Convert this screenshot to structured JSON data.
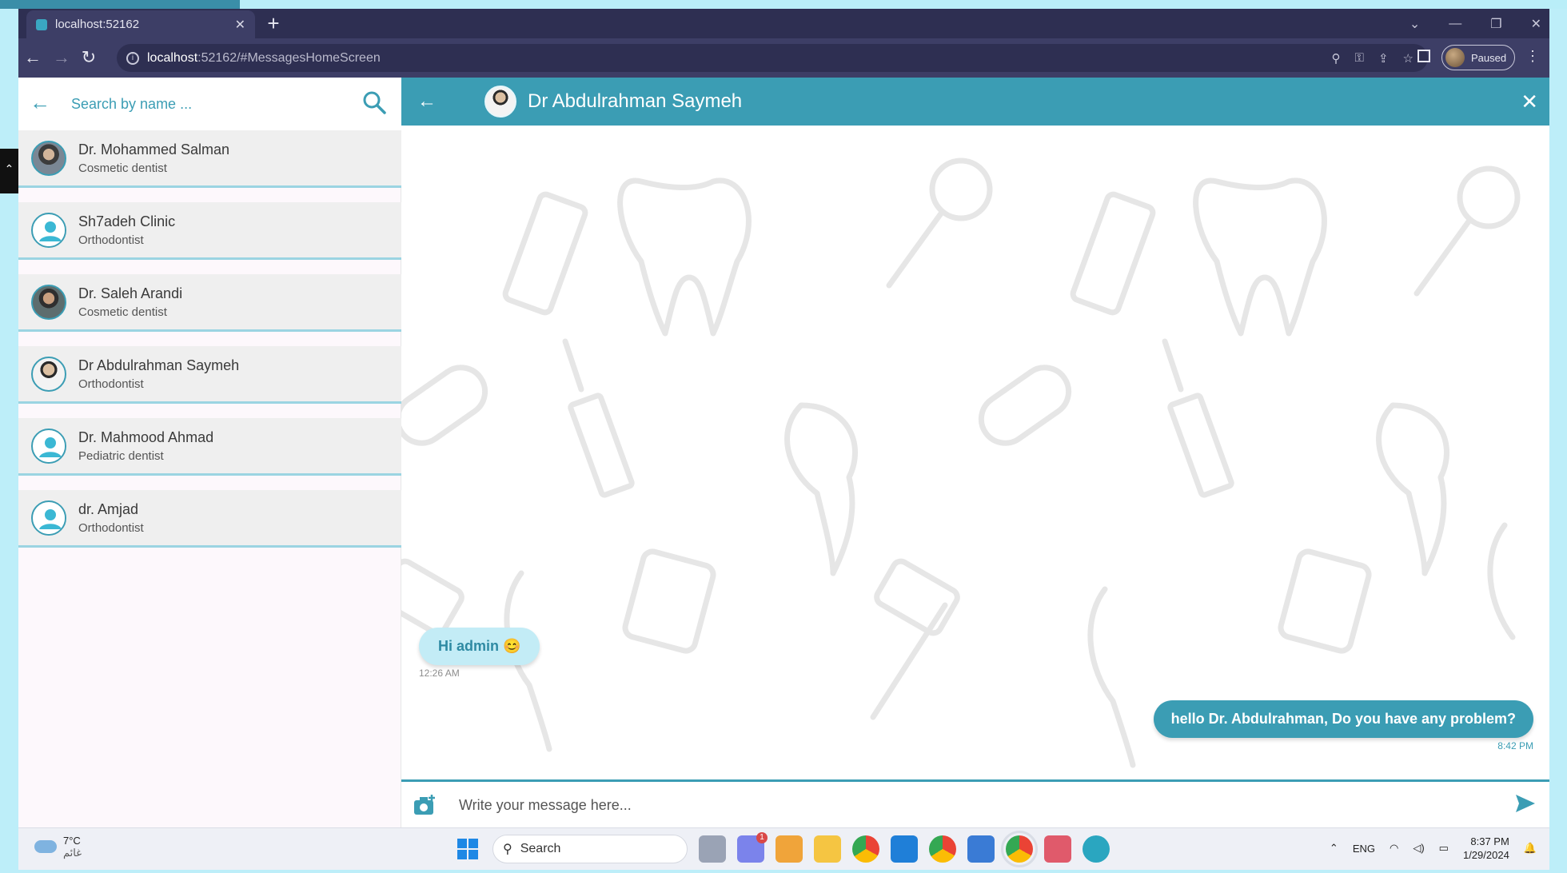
{
  "browser": {
    "tab_title": "localhost:52162",
    "url_host": "localhost",
    "url_rest": ":52162/#MessagesHomeScreen",
    "profile_status": "Paused"
  },
  "sidebar": {
    "search_placeholder": "Search by name ...",
    "contacts": [
      {
        "name": "Dr. Mohammed Salman",
        "specialty": "Cosmetic dentist",
        "avatar": "photo"
      },
      {
        "name": "Sh7adeh Clinic",
        "specialty": "Orthodontist",
        "avatar": "generic-user-icon"
      },
      {
        "name": "Dr. Saleh Arandi",
        "specialty": "Cosmetic dentist",
        "avatar": "photo"
      },
      {
        "name": "Dr Abdulrahman Saymeh",
        "specialty": "Orthodontist",
        "avatar": "photo"
      },
      {
        "name": "Dr. Mahmood Ahmad",
        "specialty": "Pediatric dentist",
        "avatar": "generic-user-icon"
      },
      {
        "name": "dr. Amjad",
        "specialty": "Orthodontist",
        "avatar": "generic-user-icon"
      }
    ]
  },
  "chat": {
    "header_title": "Dr Abdulrahman Saymeh",
    "messages": [
      {
        "direction": "incoming",
        "text": "Hi admin 😊",
        "time": "12:26 AM"
      },
      {
        "direction": "outgoing",
        "text": "hello Dr. Abdulrahman, Do you have any problem?",
        "time": "8:42 PM"
      }
    ],
    "input_placeholder": "Write your message here..."
  },
  "taskbar": {
    "weather_temp": "7°C",
    "weather_label": "غائم",
    "search_label": "Search",
    "language": "ENG",
    "time": "8:37 PM",
    "date": "1/29/2024",
    "badge_count": "1"
  },
  "colors": {
    "accent": "#3b9db4",
    "incoming_bubble": "#c3ecf6",
    "chrome_dark": "#2e2f52",
    "chrome_mid": "#3d3e66"
  }
}
